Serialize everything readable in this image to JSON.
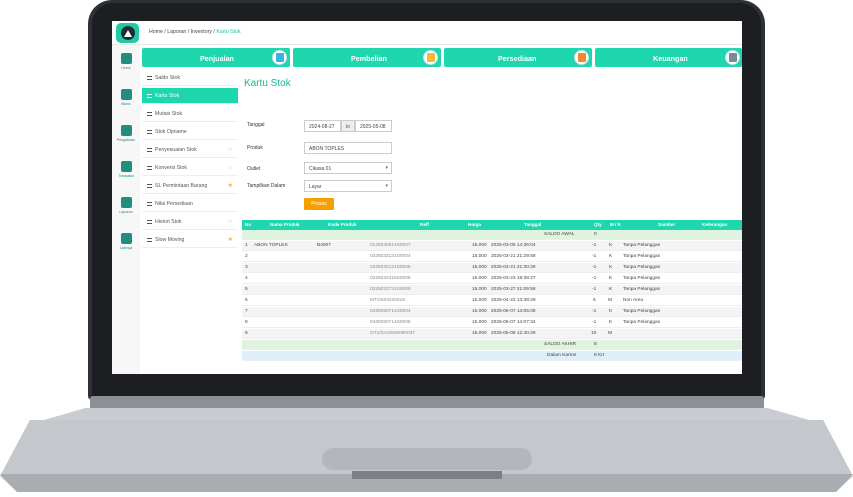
{
  "breadcrumb": {
    "home": "Home",
    "s1": "/",
    "laporan": "Laporan",
    "s2": "/",
    "inventory": "Inventory",
    "s3": "/",
    "current": "Kartu Stok"
  },
  "top_nav": [
    {
      "label": "Penjualan"
    },
    {
      "label": "Pembelian"
    },
    {
      "label": "Persediaan"
    },
    {
      "label": "Keuangan"
    }
  ],
  "rail": [
    {
      "label": "Home"
    },
    {
      "label": "Bisnis"
    },
    {
      "label": "Pengaturan"
    },
    {
      "label": "Transaksi"
    },
    {
      "label": "Laporan"
    },
    {
      "label": "Lainnya"
    }
  ],
  "submenu": [
    {
      "label": "Saldo Stok",
      "star": ""
    },
    {
      "label": "Kartu Stok",
      "star": ""
    },
    {
      "label": "Mutasi Stok",
      "star": ""
    },
    {
      "label": "Stok Opname",
      "star": ""
    },
    {
      "label": "Penyesuaian Stok",
      "star": "☆"
    },
    {
      "label": "Konversi Stok",
      "star": "☆"
    },
    {
      "label": "SL Permintaan Barang",
      "star": "★"
    },
    {
      "label": "Nilai Persediaan",
      "star": ""
    },
    {
      "label": "Histori Stok",
      "star": "☆"
    },
    {
      "label": "Slow Moving",
      "star": "★"
    }
  ],
  "page_title": "Kartu Stok",
  "form": {
    "tanggal_label": "Tanggal",
    "date_from": "2024-08-27",
    "date_sep": "to",
    "date_to": "2025-05-08",
    "produk_label": "Produk",
    "produk_value": "ABON TOPLES",
    "outlet_label": "Outlet",
    "outlet_value": "Cikasa 01",
    "tampilkan_label": "Tampilkan Dalam",
    "tampilkan_value": "Layar",
    "proses_button": "Proses",
    "caret": "▾"
  },
  "table": {
    "headers": {
      "no": "No",
      "nama": "Nama Produk",
      "kode": "Kode Produk",
      "reff": "Reff",
      "harga": "Harga",
      "tanggal": "Tanggal",
      "qty": "Qty",
      "mk": "M / K",
      "sumber": "Sumber",
      "ket": "Keterangan"
    },
    "saldo_awal": {
      "label": "SALDO AWAL",
      "qty": "0"
    },
    "rows": [
      {
        "no": "1",
        "nama": "ABON TOPLES",
        "kode": "B4007",
        "reff": "0125030514S0007",
        "harga": "15.000",
        "tanggal": "2025-03-05 14:36:04",
        "qty": "-1",
        "mk": "K",
        "sumber": "Tanpa Pelanggan"
      },
      {
        "no": "2",
        "nama": "",
        "kode": "",
        "reff": "0325032121S0004",
        "harga": "15.000",
        "tanggal": "2025-03-21 21:29:58",
        "qty": "-1",
        "mk": "K",
        "sumber": "Tanpa Pelanggan"
      },
      {
        "no": "3",
        "nama": "",
        "kode": "",
        "reff": "0325032121S0005",
        "harga": "15.000",
        "tanggal": "2025-03-21 21:30:28",
        "qty": "-1",
        "mk": "K",
        "sumber": "Tanpa Pelanggan"
      },
      {
        "no": "4",
        "nama": "",
        "kode": "",
        "reff": "0325032318S0006",
        "harga": "15.000",
        "tanggal": "2025-03-23 18:38:27",
        "qty": "-1",
        "mk": "K",
        "sumber": "Tanpa Pelanggan"
      },
      {
        "no": "5",
        "nama": "",
        "kode": "",
        "reff": "0325032721S0009",
        "harga": "15.000",
        "tanggal": "2025-03-27 21:09:56",
        "qty": "-1",
        "mk": "K",
        "sumber": "Tanpa Pelanggan"
      },
      {
        "no": "6",
        "nama": "",
        "kode": "",
        "reff": "MT/2504220018",
        "harga": "15.000",
        "tanggal": "2025-04-22 13:38:29",
        "qty": "5",
        "mk": "M",
        "sumber": "Non Area"
      },
      {
        "no": "7",
        "nama": "",
        "kode": "",
        "reff": "0425050714S0004",
        "harga": "15.000",
        "tanggal": "2025-05-07 14:05:08",
        "qty": "-1",
        "mk": "K",
        "sumber": "Tanpa Pelanggan"
      },
      {
        "no": "8",
        "nama": "",
        "kode": "",
        "reff": "0425050714S0006",
        "harga": "15.000",
        "tanggal": "2025-05-07 14:07:34",
        "qty": "-1",
        "mk": "K",
        "sumber": "Tanpa Pelanggan"
      },
      {
        "no": "9",
        "nama": "",
        "kode": "",
        "reff": "OT1/SA/2505080037",
        "harga": "15.000",
        "tanggal": "2025-05-08 12:40:28",
        "qty": "10",
        "mk": "M",
        "sumber": ""
      }
    ],
    "saldo_akhir": {
      "label": "SALDO AKHIR",
      "qty": "8"
    },
    "dalam_karton": {
      "label": "Dalam Karton",
      "qty": "8 Krt"
    }
  },
  "colors": {
    "accent": "#1ed7ae",
    "proses": "#f5a000"
  }
}
